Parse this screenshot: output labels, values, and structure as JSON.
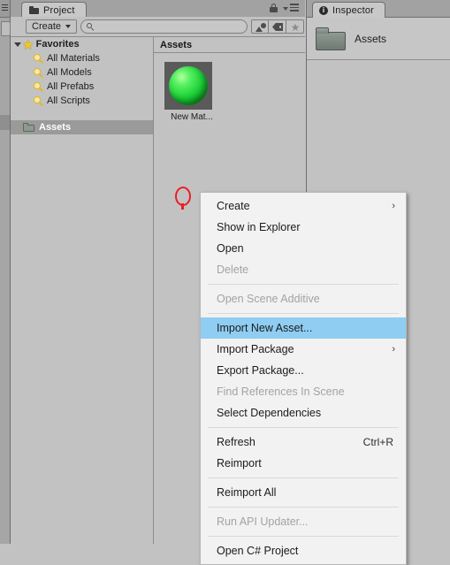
{
  "project_panel": {
    "tab_label": "Project",
    "tab_icon": "folder-icon",
    "lock_icon": "lock-icon",
    "panel_menu_icon": "hamburger-menu-icon",
    "toolbar": {
      "create_label": "Create",
      "create_caret": "▾",
      "search_placeholder": "",
      "search_value": "",
      "search_icon": "search-icon",
      "filters": [
        {
          "name": "filter-by-type-button",
          "icon": "shapes-icon"
        },
        {
          "name": "filter-by-label-button",
          "icon": "tag-icon"
        },
        {
          "name": "filter-favorites-button",
          "icon": "star-icon",
          "glyph": "★"
        }
      ]
    },
    "tree": {
      "favorites": {
        "label": "Favorites",
        "expand_arrow": "▼",
        "icon": "star-icon",
        "glyph": "★"
      },
      "children": [
        {
          "label": "All Materials",
          "icon": "magnifier-icon"
        },
        {
          "label": "All Models",
          "icon": "magnifier-icon"
        },
        {
          "label": "All Prefabs",
          "icon": "magnifier-icon"
        },
        {
          "label": "All Scripts",
          "icon": "magnifier-icon"
        }
      ],
      "assets_row": {
        "label": "Assets",
        "icon": "folder-icon",
        "selected": true
      }
    },
    "content": {
      "breadcrumb": "Assets",
      "items": [
        {
          "label": "New Mat...",
          "icon": "material-sphere-icon",
          "color": "#1fd23a"
        }
      ]
    }
  },
  "inspector_panel": {
    "tab_label": "Inspector",
    "tab_icon": "info-icon",
    "info_glyph": "i",
    "header_title": "Assets",
    "header_icon": "folder-icon"
  },
  "annotation": {
    "name": "right-click-marker",
    "color": "#ee1b24"
  },
  "context_menu": {
    "items": [
      {
        "label": "Create",
        "disabled": false,
        "submenu": true,
        "arrow": "›",
        "shortcut": ""
      },
      {
        "label": "Show in Explorer",
        "disabled": false,
        "submenu": false,
        "arrow": "",
        "shortcut": ""
      },
      {
        "label": "Open",
        "disabled": false,
        "submenu": false,
        "arrow": "",
        "shortcut": ""
      },
      {
        "label": "Delete",
        "disabled": true,
        "submenu": false,
        "arrow": "",
        "shortcut": ""
      },
      {
        "separator": true
      },
      {
        "label": "Open Scene Additive",
        "disabled": true,
        "submenu": false,
        "arrow": "",
        "shortcut": ""
      },
      {
        "separator": true
      },
      {
        "label": "Import New Asset...",
        "disabled": false,
        "submenu": false,
        "arrow": "",
        "shortcut": "",
        "highlighted": true
      },
      {
        "label": "Import Package",
        "disabled": false,
        "submenu": true,
        "arrow": "›",
        "shortcut": ""
      },
      {
        "label": "Export Package...",
        "disabled": false,
        "submenu": false,
        "arrow": "",
        "shortcut": ""
      },
      {
        "label": "Find References In Scene",
        "disabled": true,
        "submenu": false,
        "arrow": "",
        "shortcut": ""
      },
      {
        "label": "Select Dependencies",
        "disabled": false,
        "submenu": false,
        "arrow": "",
        "shortcut": ""
      },
      {
        "separator": true
      },
      {
        "label": "Refresh",
        "disabled": false,
        "submenu": false,
        "arrow": "",
        "shortcut": "Ctrl+R"
      },
      {
        "label": "Reimport",
        "disabled": false,
        "submenu": false,
        "arrow": "",
        "shortcut": ""
      },
      {
        "separator": true
      },
      {
        "label": "Reimport All",
        "disabled": false,
        "submenu": false,
        "arrow": "",
        "shortcut": ""
      },
      {
        "separator": true
      },
      {
        "label": "Run API Updater...",
        "disabled": true,
        "submenu": false,
        "arrow": "",
        "shortcut": ""
      },
      {
        "separator": true
      },
      {
        "label": "Open C# Project",
        "disabled": false,
        "submenu": false,
        "arrow": "",
        "shortcut": ""
      }
    ]
  }
}
